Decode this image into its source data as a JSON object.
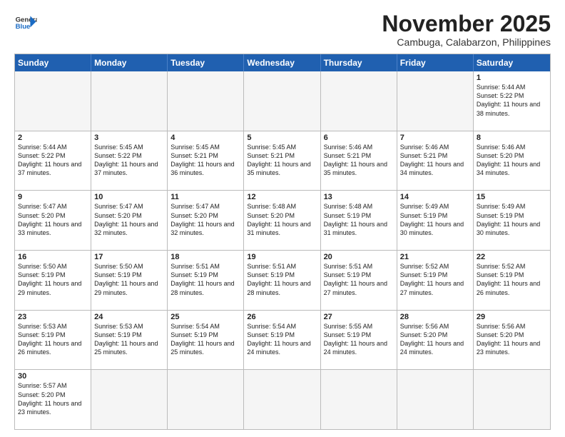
{
  "header": {
    "logo_general": "General",
    "logo_blue": "Blue",
    "month_title": "November 2025",
    "location": "Cambuga, Calabarzon, Philippines"
  },
  "weekdays": [
    "Sunday",
    "Monday",
    "Tuesday",
    "Wednesday",
    "Thursday",
    "Friday",
    "Saturday"
  ],
  "rows": [
    [
      {
        "day": "",
        "info": "",
        "empty": true
      },
      {
        "day": "",
        "info": "",
        "empty": true
      },
      {
        "day": "",
        "info": "",
        "empty": true
      },
      {
        "day": "",
        "info": "",
        "empty": true
      },
      {
        "day": "",
        "info": "",
        "empty": true
      },
      {
        "day": "",
        "info": "",
        "empty": true
      },
      {
        "day": "1",
        "info": "Sunrise: 5:44 AM\nSunset: 5:22 PM\nDaylight: 11 hours\nand 38 minutes."
      }
    ],
    [
      {
        "day": "2",
        "info": "Sunrise: 5:44 AM\nSunset: 5:22 PM\nDaylight: 11 hours\nand 37 minutes."
      },
      {
        "day": "3",
        "info": "Sunrise: 5:45 AM\nSunset: 5:22 PM\nDaylight: 11 hours\nand 37 minutes."
      },
      {
        "day": "4",
        "info": "Sunrise: 5:45 AM\nSunset: 5:21 PM\nDaylight: 11 hours\nand 36 minutes."
      },
      {
        "day": "5",
        "info": "Sunrise: 5:45 AM\nSunset: 5:21 PM\nDaylight: 11 hours\nand 35 minutes."
      },
      {
        "day": "6",
        "info": "Sunrise: 5:46 AM\nSunset: 5:21 PM\nDaylight: 11 hours\nand 35 minutes."
      },
      {
        "day": "7",
        "info": "Sunrise: 5:46 AM\nSunset: 5:21 PM\nDaylight: 11 hours\nand 34 minutes."
      },
      {
        "day": "8",
        "info": "Sunrise: 5:46 AM\nSunset: 5:20 PM\nDaylight: 11 hours\nand 34 minutes."
      }
    ],
    [
      {
        "day": "9",
        "info": "Sunrise: 5:47 AM\nSunset: 5:20 PM\nDaylight: 11 hours\nand 33 minutes."
      },
      {
        "day": "10",
        "info": "Sunrise: 5:47 AM\nSunset: 5:20 PM\nDaylight: 11 hours\nand 32 minutes."
      },
      {
        "day": "11",
        "info": "Sunrise: 5:47 AM\nSunset: 5:20 PM\nDaylight: 11 hours\nand 32 minutes."
      },
      {
        "day": "12",
        "info": "Sunrise: 5:48 AM\nSunset: 5:20 PM\nDaylight: 11 hours\nand 31 minutes."
      },
      {
        "day": "13",
        "info": "Sunrise: 5:48 AM\nSunset: 5:19 PM\nDaylight: 11 hours\nand 31 minutes."
      },
      {
        "day": "14",
        "info": "Sunrise: 5:49 AM\nSunset: 5:19 PM\nDaylight: 11 hours\nand 30 minutes."
      },
      {
        "day": "15",
        "info": "Sunrise: 5:49 AM\nSunset: 5:19 PM\nDaylight: 11 hours\nand 30 minutes."
      }
    ],
    [
      {
        "day": "16",
        "info": "Sunrise: 5:50 AM\nSunset: 5:19 PM\nDaylight: 11 hours\nand 29 minutes."
      },
      {
        "day": "17",
        "info": "Sunrise: 5:50 AM\nSunset: 5:19 PM\nDaylight: 11 hours\nand 29 minutes."
      },
      {
        "day": "18",
        "info": "Sunrise: 5:51 AM\nSunset: 5:19 PM\nDaylight: 11 hours\nand 28 minutes."
      },
      {
        "day": "19",
        "info": "Sunrise: 5:51 AM\nSunset: 5:19 PM\nDaylight: 11 hours\nand 28 minutes."
      },
      {
        "day": "20",
        "info": "Sunrise: 5:51 AM\nSunset: 5:19 PM\nDaylight: 11 hours\nand 27 minutes."
      },
      {
        "day": "21",
        "info": "Sunrise: 5:52 AM\nSunset: 5:19 PM\nDaylight: 11 hours\nand 27 minutes."
      },
      {
        "day": "22",
        "info": "Sunrise: 5:52 AM\nSunset: 5:19 PM\nDaylight: 11 hours\nand 26 minutes."
      }
    ],
    [
      {
        "day": "23",
        "info": "Sunrise: 5:53 AM\nSunset: 5:19 PM\nDaylight: 11 hours\nand 26 minutes."
      },
      {
        "day": "24",
        "info": "Sunrise: 5:53 AM\nSunset: 5:19 PM\nDaylight: 11 hours\nand 25 minutes."
      },
      {
        "day": "25",
        "info": "Sunrise: 5:54 AM\nSunset: 5:19 PM\nDaylight: 11 hours\nand 25 minutes."
      },
      {
        "day": "26",
        "info": "Sunrise: 5:54 AM\nSunset: 5:19 PM\nDaylight: 11 hours\nand 24 minutes."
      },
      {
        "day": "27",
        "info": "Sunrise: 5:55 AM\nSunset: 5:19 PM\nDaylight: 11 hours\nand 24 minutes."
      },
      {
        "day": "28",
        "info": "Sunrise: 5:56 AM\nSunset: 5:20 PM\nDaylight: 11 hours\nand 24 minutes."
      },
      {
        "day": "29",
        "info": "Sunrise: 5:56 AM\nSunset: 5:20 PM\nDaylight: 11 hours\nand 23 minutes."
      }
    ],
    [
      {
        "day": "30",
        "info": "Sunrise: 5:57 AM\nSunset: 5:20 PM\nDaylight: 11 hours\nand 23 minutes."
      },
      {
        "day": "",
        "info": "",
        "empty": true
      },
      {
        "day": "",
        "info": "",
        "empty": true
      },
      {
        "day": "",
        "info": "",
        "empty": true
      },
      {
        "day": "",
        "info": "",
        "empty": true
      },
      {
        "day": "",
        "info": "",
        "empty": true
      },
      {
        "day": "",
        "info": "",
        "empty": true
      }
    ]
  ]
}
